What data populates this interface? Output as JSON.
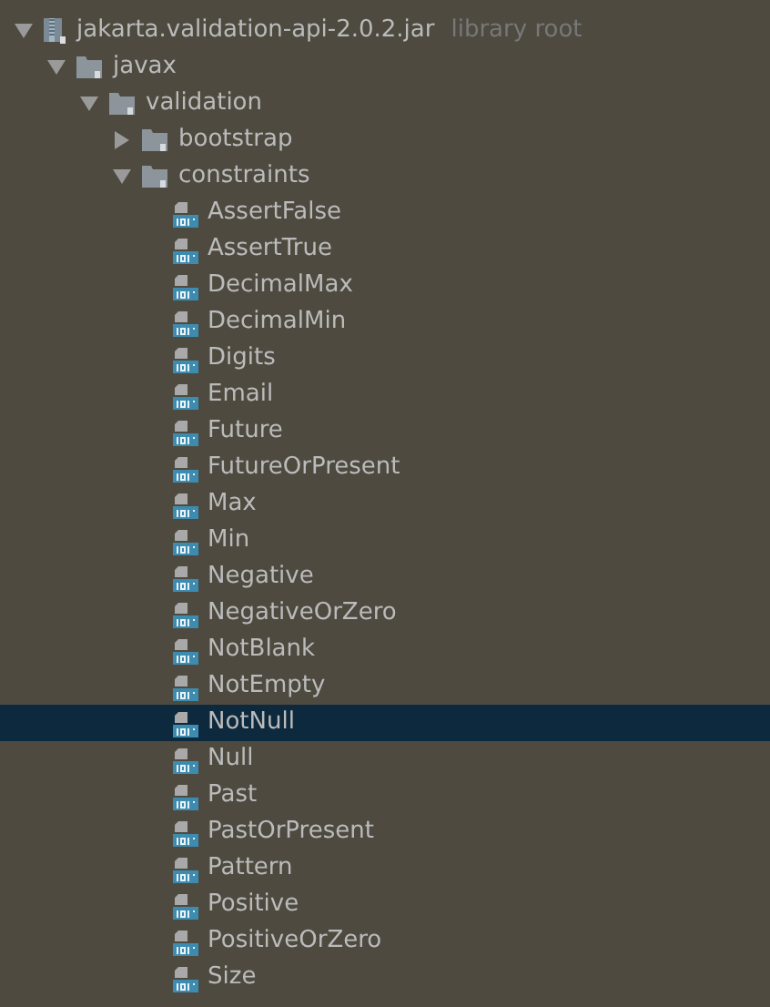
{
  "tree": [
    {
      "kind": "jar",
      "label": "jakarta.validation-api-2.0.2.jar",
      "note": "library root",
      "expanded": true,
      "selected": false,
      "children": [
        {
          "kind": "package",
          "label": "javax",
          "expanded": true,
          "selected": false,
          "children": [
            {
              "kind": "package",
              "label": "validation",
              "expanded": true,
              "selected": false,
              "children": [
                {
                  "kind": "package",
                  "label": "bootstrap",
                  "expanded": false,
                  "selected": false
                },
                {
                  "kind": "package",
                  "label": "constraints",
                  "expanded": true,
                  "selected": false,
                  "children": [
                    {
                      "kind": "class",
                      "label": "AssertFalse",
                      "selected": false
                    },
                    {
                      "kind": "class",
                      "label": "AssertTrue",
                      "selected": false
                    },
                    {
                      "kind": "class",
                      "label": "DecimalMax",
                      "selected": false
                    },
                    {
                      "kind": "class",
                      "label": "DecimalMin",
                      "selected": false
                    },
                    {
                      "kind": "class",
                      "label": "Digits",
                      "selected": false
                    },
                    {
                      "kind": "class",
                      "label": "Email",
                      "selected": false
                    },
                    {
                      "kind": "class",
                      "label": "Future",
                      "selected": false
                    },
                    {
                      "kind": "class",
                      "label": "FutureOrPresent",
                      "selected": false
                    },
                    {
                      "kind": "class",
                      "label": "Max",
                      "selected": false
                    },
                    {
                      "kind": "class",
                      "label": "Min",
                      "selected": false
                    },
                    {
                      "kind": "class",
                      "label": "Negative",
                      "selected": false
                    },
                    {
                      "kind": "class",
                      "label": "NegativeOrZero",
                      "selected": false
                    },
                    {
                      "kind": "class",
                      "label": "NotBlank",
                      "selected": false
                    },
                    {
                      "kind": "class",
                      "label": "NotEmpty",
                      "selected": false
                    },
                    {
                      "kind": "class",
                      "label": "NotNull",
                      "selected": true
                    },
                    {
                      "kind": "class",
                      "label": "Null",
                      "selected": false
                    },
                    {
                      "kind": "class",
                      "label": "Past",
                      "selected": false
                    },
                    {
                      "kind": "class",
                      "label": "PastOrPresent",
                      "selected": false
                    },
                    {
                      "kind": "class",
                      "label": "Pattern",
                      "selected": false
                    },
                    {
                      "kind": "class",
                      "label": "Positive",
                      "selected": false
                    },
                    {
                      "kind": "class",
                      "label": "PositiveOrZero",
                      "selected": false
                    },
                    {
                      "kind": "class",
                      "label": "Size",
                      "selected": false
                    }
                  ]
                }
              ]
            }
          ]
        }
      ]
    }
  ]
}
